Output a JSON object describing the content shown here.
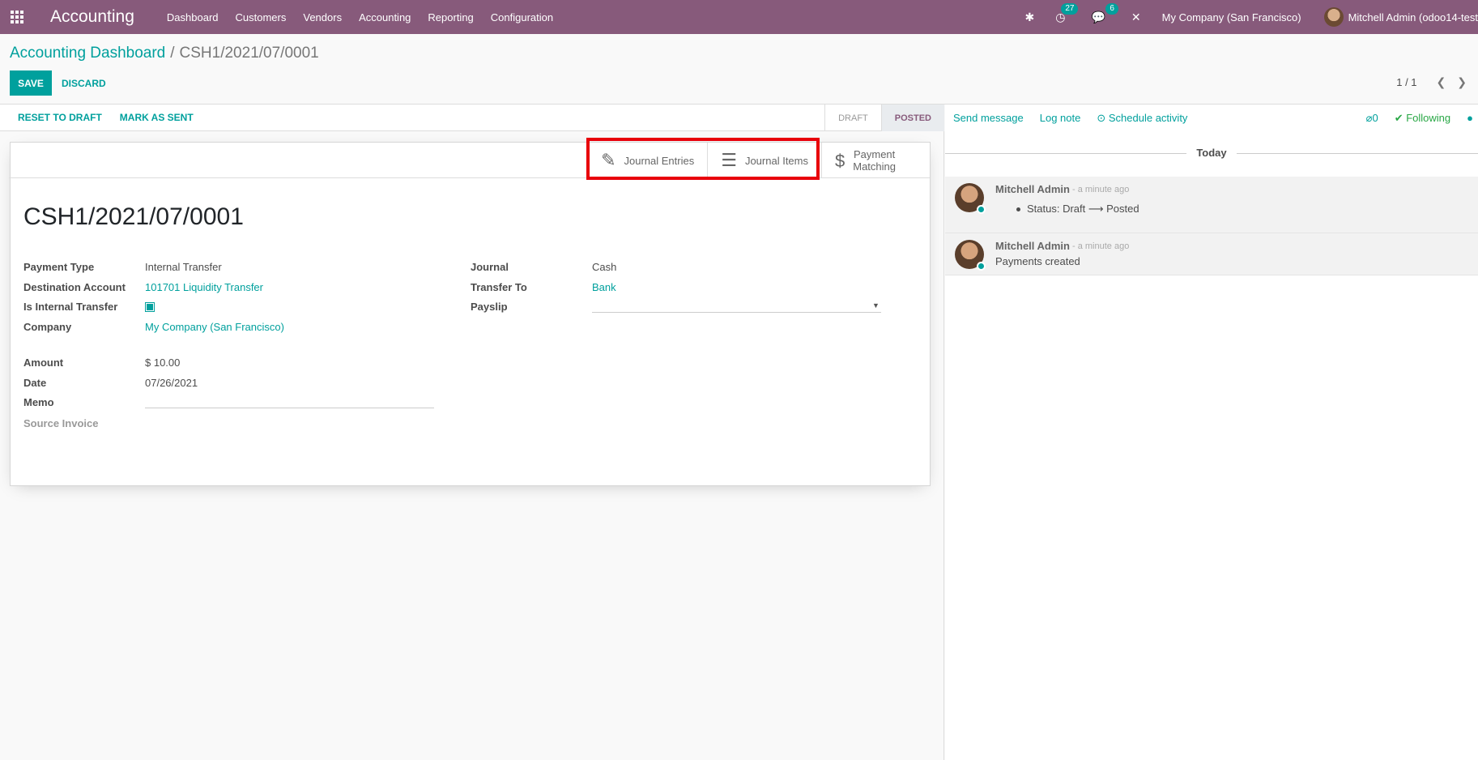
{
  "navbar": {
    "brand": "Accounting",
    "menu": [
      "Dashboard",
      "Customers",
      "Vendors",
      "Accounting",
      "Reporting",
      "Configuration"
    ],
    "activities_count": "27",
    "messages_count": "6",
    "company": "My Company (San Francisco)",
    "user": "Mitchell Admin (odoo14-test"
  },
  "breadcrumb": {
    "parent": "Accounting Dashboard",
    "separator": "/",
    "current": "CSH1/2021/07/0001"
  },
  "control": {
    "save_label": "SAVE",
    "discard_label": "DISCARD",
    "pager_value": "1 / 1"
  },
  "statusbar": {
    "reset_label": "RESET TO DRAFT",
    "mark_sent_label": "MARK AS SENT",
    "stages": [
      "DRAFT",
      "POSTED"
    ],
    "active_stage": "POSTED"
  },
  "smart_buttons": {
    "journal_entries": "Journal Entries",
    "journal_items": "Journal Items",
    "payment_matching_line1": "Payment",
    "payment_matching_line2": "Matching"
  },
  "record": {
    "title": "CSH1/2021/07/0001",
    "left_fields": {
      "payment_type_label": "Payment Type",
      "payment_type_value": "Internal Transfer",
      "destination_label": "Destination Account",
      "destination_value": "101701 Liquidity Transfer",
      "internal_label": "Is Internal Transfer",
      "company_label": "Company",
      "company_value": "My Company (San Francisco)",
      "amount_label": "Amount",
      "amount_value": "$ 10.00",
      "date_label": "Date",
      "date_value": "07/26/2021",
      "memo_label": "Memo",
      "source_invoice_label": "Source Invoice"
    },
    "right_fields": {
      "journal_label": "Journal",
      "journal_value": "Cash",
      "transfer_to_label": "Transfer To",
      "transfer_to_value": "Bank",
      "payslip_label": "Payslip"
    }
  },
  "chatter": {
    "send_message": "Send message",
    "log_note": "Log note",
    "schedule_activity": "Schedule activity",
    "attachments": "0",
    "following": "Following",
    "day": "Today",
    "messages": [
      {
        "author": "Mitchell Admin",
        "time": "- a minute ago",
        "tracking": "Status: Draft",
        "tracking_new": "Posted"
      },
      {
        "author": "Mitchell Admin",
        "time": "- a minute ago",
        "body": "Payments created"
      }
    ]
  },
  "colors": {
    "navbar": "#875a7b",
    "primary": "#00a09d",
    "highlight": "#e8000b",
    "following": "#28a745"
  }
}
